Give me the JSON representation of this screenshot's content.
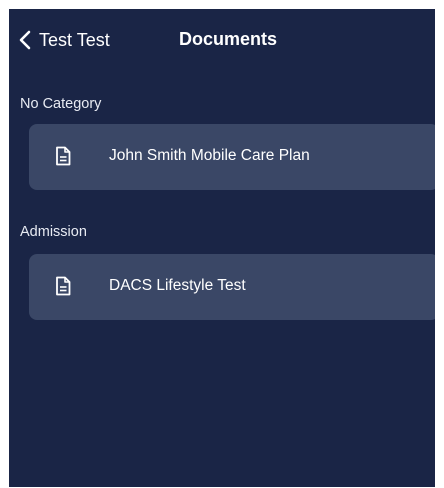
{
  "nav": {
    "back_label": "Test Test",
    "title": "Documents"
  },
  "sections": [
    {
      "header": "No Category",
      "documents": [
        {
          "label": "John Smith Mobile Care Plan",
          "icon": "document-icon"
        }
      ]
    },
    {
      "header": "Admission",
      "documents": [
        {
          "label": "DACS Lifestyle Test",
          "icon": "document-icon"
        }
      ]
    }
  ],
  "colors": {
    "background": "#1a2546",
    "card": "#3a4766",
    "text": "#ffffff"
  }
}
